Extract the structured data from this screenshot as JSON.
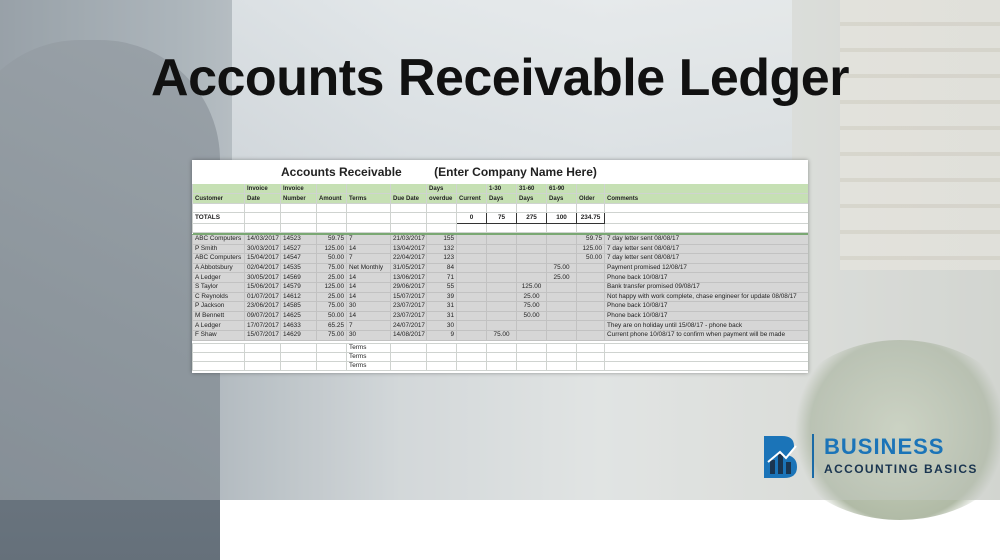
{
  "title": "Accounts Receivable Ledger",
  "sheet": {
    "heading": "Accounts Receivable",
    "company": "(Enter Company Name Here)",
    "headers": {
      "customer": "Customer",
      "invoice_date": [
        "Invoice",
        "Date"
      ],
      "invoice_number": [
        "Invoice",
        "Number"
      ],
      "amount": "Amount",
      "terms": "Terms",
      "due_date": "Due Date",
      "days_overdue": [
        "Days",
        "overdue"
      ],
      "current": "Current",
      "d1_30": [
        "1-30",
        "Days"
      ],
      "d31_60": [
        "31-60",
        "Days"
      ],
      "d61_90": [
        "61-90",
        "Days"
      ],
      "older": "Older",
      "comments": "Comments"
    },
    "totals": {
      "label": "TOTALS",
      "current": "0",
      "d1_30": "75",
      "d31_60": "275",
      "d61_90": "100",
      "older": "234.75"
    },
    "rows": [
      {
        "customer": "ABC Computers",
        "date": "14/03/2017",
        "inv": "14523",
        "amount": "59.75",
        "terms": "7",
        "due": "21/03/2017",
        "overdue": "155",
        "current": "",
        "d1_30": "",
        "d31_60": "",
        "d61_90": "",
        "older": "59.75",
        "comments": "7 day letter sent 08/08/17"
      },
      {
        "customer": "P Smith",
        "date": "30/03/2017",
        "inv": "14527",
        "amount": "125.00",
        "terms": "14",
        "due": "13/04/2017",
        "overdue": "132",
        "current": "",
        "d1_30": "",
        "d31_60": "",
        "d61_90": "",
        "older": "125.00",
        "comments": "7 day letter sent 08/08/17"
      },
      {
        "customer": "ABC Computers",
        "date": "15/04/2017",
        "inv": "14547",
        "amount": "50.00",
        "terms": "7",
        "due": "22/04/2017",
        "overdue": "123",
        "current": "",
        "d1_30": "",
        "d31_60": "",
        "d61_90": "",
        "older": "50.00",
        "comments": "7 day letter sent 08/08/17"
      },
      {
        "customer": "A Abbotsbury",
        "date": "02/04/2017",
        "inv": "14535",
        "amount": "75.00",
        "terms": "Net Monthly",
        "due": "31/05/2017",
        "overdue": "84",
        "current": "",
        "d1_30": "",
        "d31_60": "",
        "d61_90": "75.00",
        "older": "",
        "comments": "Payment promised 12/08/17"
      },
      {
        "customer": "A Ledger",
        "date": "30/05/2017",
        "inv": "14569",
        "amount": "25.00",
        "terms": "14",
        "due": "13/06/2017",
        "overdue": "71",
        "current": "",
        "d1_30": "",
        "d31_60": "",
        "d61_90": "25.00",
        "older": "",
        "comments": "Phone back 10/08/17"
      },
      {
        "customer": "S Taylor",
        "date": "15/06/2017",
        "inv": "14579",
        "amount": "125.00",
        "terms": "14",
        "due": "29/06/2017",
        "overdue": "55",
        "current": "",
        "d1_30": "",
        "d31_60": "125.00",
        "d61_90": "",
        "older": "",
        "comments": "Bank transfer promised 09/08/17"
      },
      {
        "customer": "C Reynolds",
        "date": "01/07/2017",
        "inv": "14612",
        "amount": "25.00",
        "terms": "14",
        "due": "15/07/2017",
        "overdue": "39",
        "current": "",
        "d1_30": "",
        "d31_60": "25.00",
        "d61_90": "",
        "older": "",
        "comments": "Not happy with work complete, chase engineer for update 08/08/17"
      },
      {
        "customer": "P Jackson",
        "date": "23/06/2017",
        "inv": "14585",
        "amount": "75.00",
        "terms": "30",
        "due": "23/07/2017",
        "overdue": "31",
        "current": "",
        "d1_30": "",
        "d31_60": "75.00",
        "d61_90": "",
        "older": "",
        "comments": "Phone back 10/08/17"
      },
      {
        "customer": "M Bennett",
        "date": "09/07/2017",
        "inv": "14625",
        "amount": "50.00",
        "terms": "14",
        "due": "23/07/2017",
        "overdue": "31",
        "current": "",
        "d1_30": "",
        "d31_60": "50.00",
        "d61_90": "",
        "older": "",
        "comments": "Phone back 10/08/17"
      },
      {
        "customer": "A Ledger",
        "date": "17/07/2017",
        "inv": "14633",
        "amount": "65.25",
        "terms": "7",
        "due": "24/07/2017",
        "overdue": "30",
        "current": "",
        "d1_30": "",
        "d31_60": "",
        "d61_90": "",
        "older": "",
        "comments": "They are on holiday until 15/08/17 - phone back"
      },
      {
        "customer": "F Shaw",
        "date": "15/07/2017",
        "inv": "14629",
        "amount": "75.00",
        "terms": "30",
        "due": "14/08/2017",
        "overdue": "9",
        "current": "",
        "d1_30": "75.00",
        "d31_60": "",
        "d61_90": "",
        "older": "",
        "comments": "Current phone 10/08/17 to confirm when payment will be made"
      }
    ],
    "terms_rows": [
      "Terms",
      "Terms",
      "Terms"
    ]
  },
  "logo": {
    "line1": "BUSINESS",
    "line2": "ACCOUNTING BASICS",
    "colors": {
      "primary": "#1b74b8",
      "dark": "#1a3550"
    }
  },
  "colors": {
    "header_green": "#c6e0b4",
    "row_grey": "#d6d6d6"
  }
}
